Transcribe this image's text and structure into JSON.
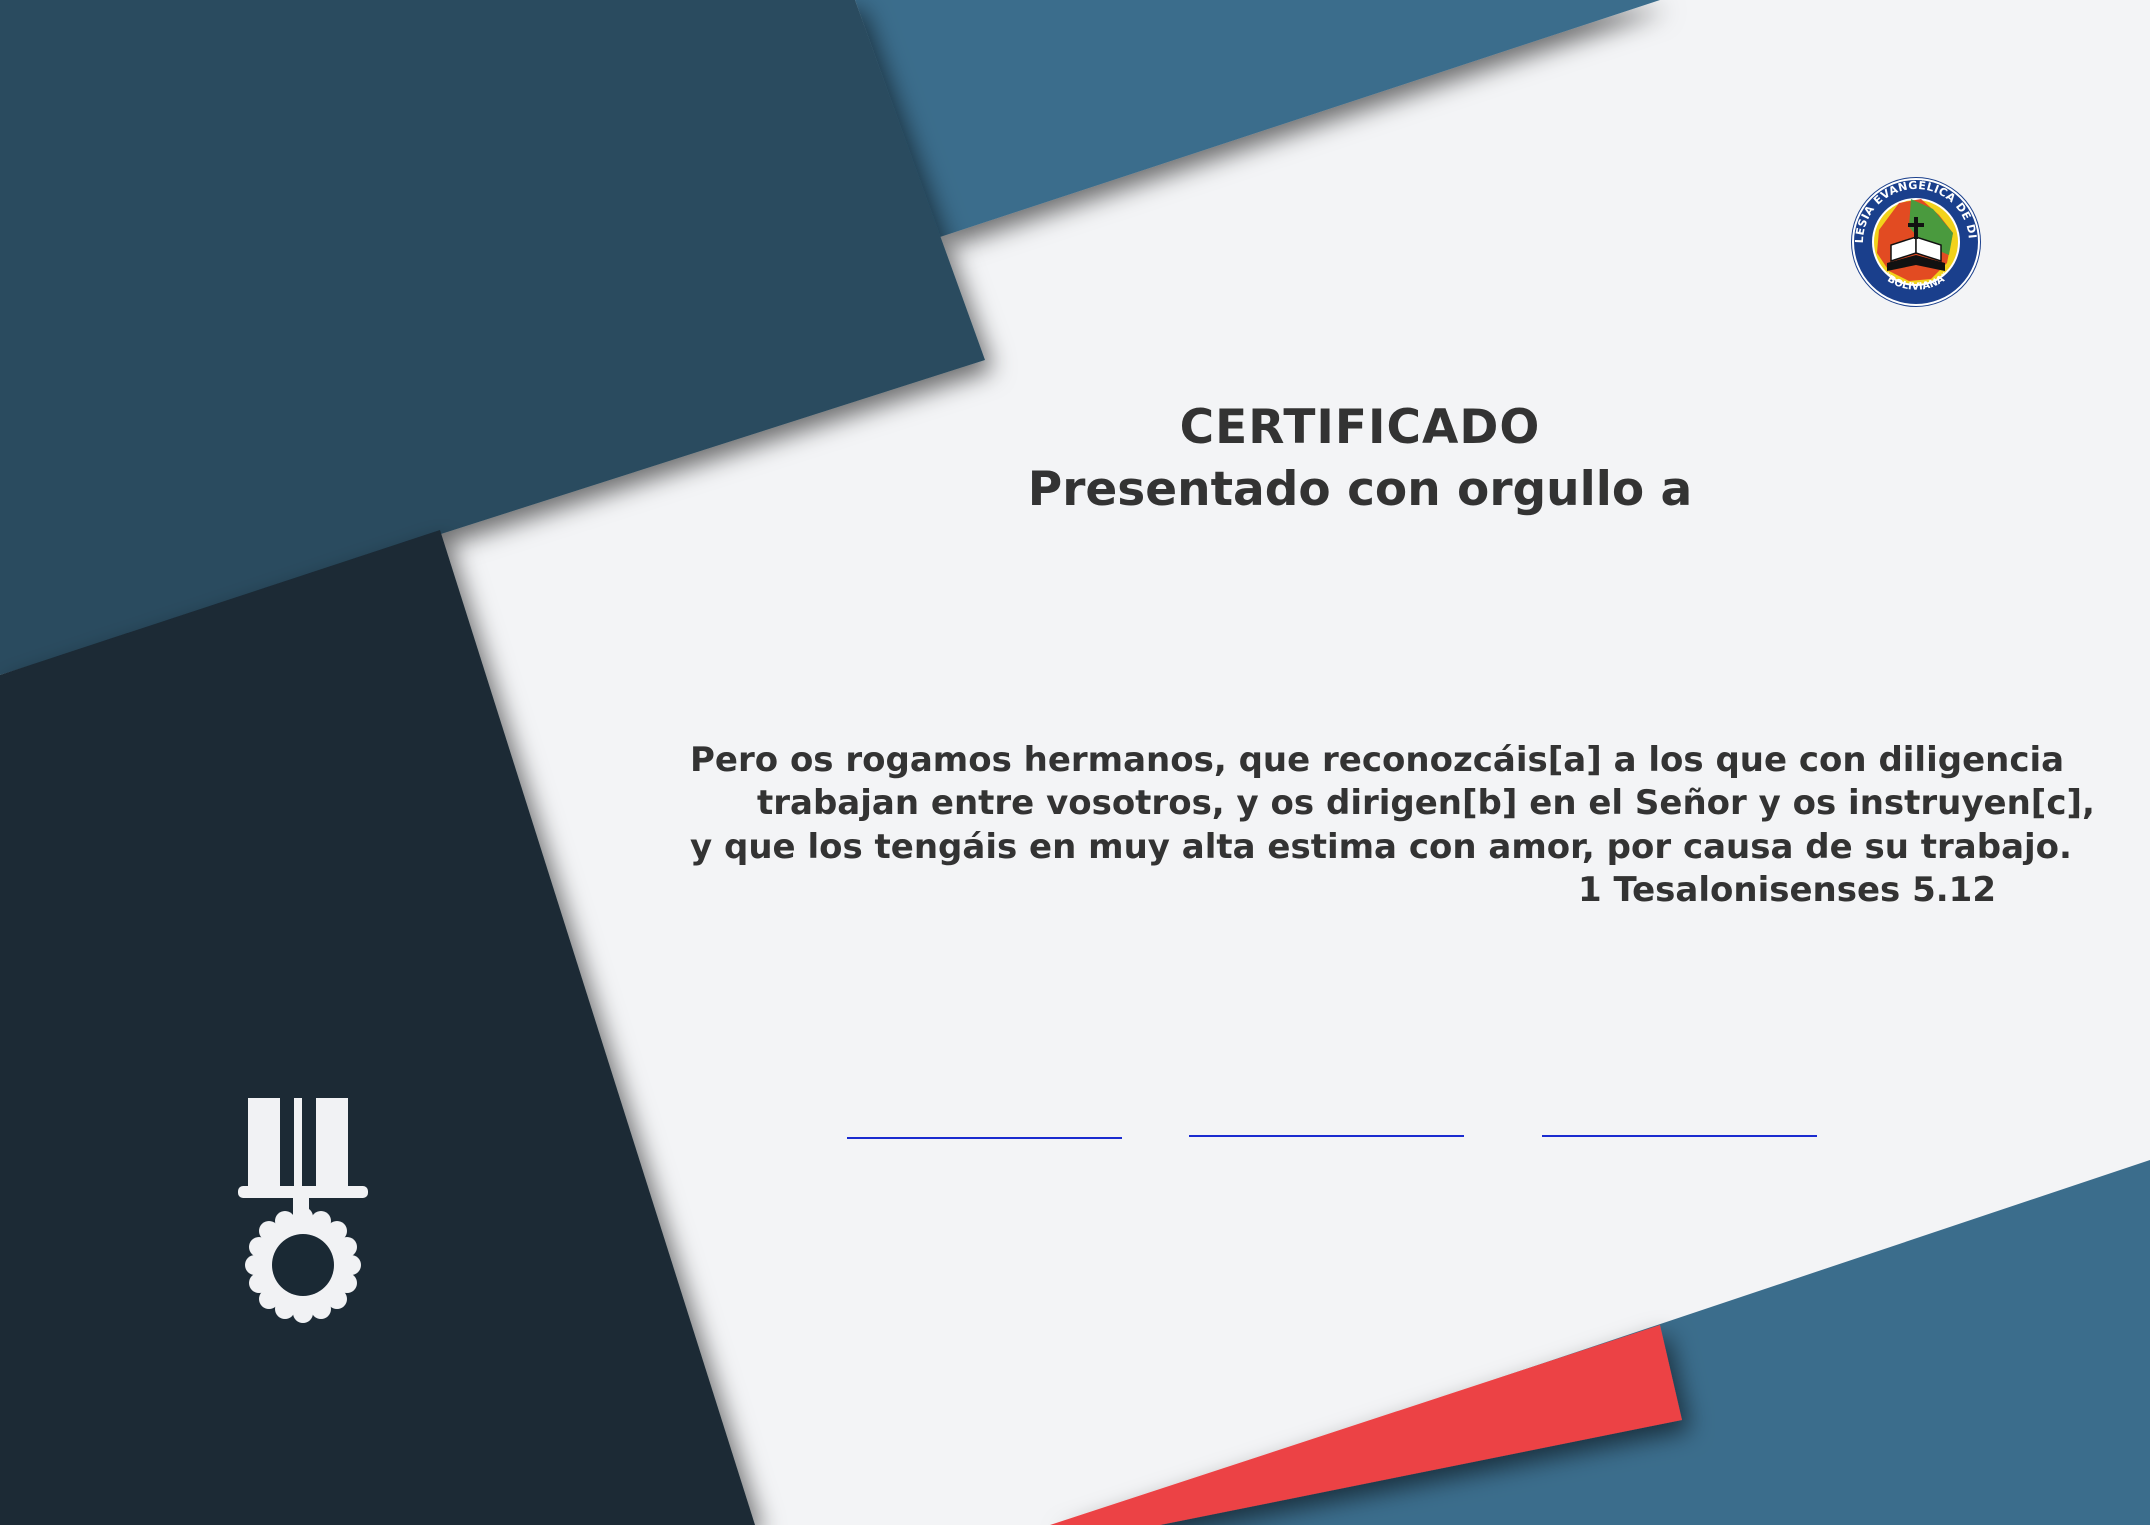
{
  "certificate": {
    "title": "CERTIFICADO",
    "subtitle": "Presentado con orgullo a",
    "verse_lines": [
      "Pero os rogamos hermanos, que reconozcáis[a] a los que con diligencia",
      "trabajan entre vosotros, y os dirigen[b] en el Señor y os instruyen[c],",
      "y que los tengáis en muy alta estima con amor, por causa de su trabajo."
    ],
    "verse_reference": "1 Tesalonisenses 5.12",
    "signature_lines": 3
  },
  "logo": {
    "ring_text": "IGLESIA EVANGÉLICA DE DIOS",
    "bottom_text": "\"BOLIVIANA\""
  },
  "icons": {
    "medal": "medal-icon"
  },
  "colors": {
    "background": "#f3f4f6",
    "dark_panel": "#1a2934",
    "mid_panel": "#294b5f",
    "steel_blue": "#3b6d8c",
    "accent_red": "#ec4244",
    "text": "#333333",
    "signature_line": "#1a2bd0"
  }
}
